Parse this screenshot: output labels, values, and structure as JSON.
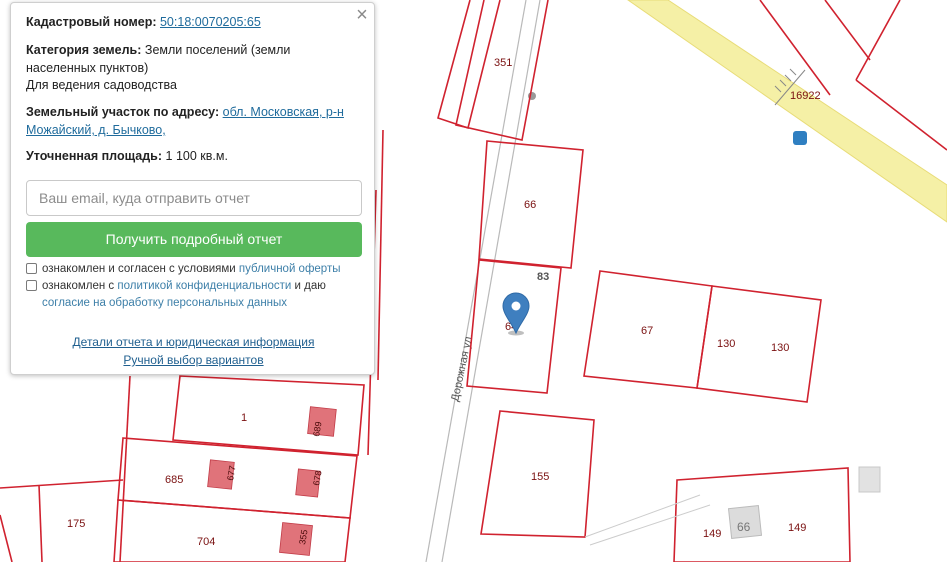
{
  "map": {
    "street_label": "Дорожная ул.",
    "plot_labels": {
      "p351": "351",
      "p16922": "16922",
      "p66": "66",
      "p83": "83",
      "pSel": "64",
      "p67": "67",
      "p130a": "130",
      "p130b": "130",
      "p155": "155",
      "p1": "1",
      "p685": "685",
      "p704": "704",
      "p175": "175",
      "p149a": "149",
      "p149b": "149"
    },
    "building_labels": {
      "b689": "689",
      "b677": "677",
      "b678": "678",
      "b355": "355",
      "b66": "66"
    },
    "colors": {
      "boundary": "#d0222f",
      "road": "#f5f0a6",
      "building": "#e0737a",
      "marker": "#3f7fbf"
    }
  },
  "popup": {
    "cadastral_label": "Кадастровый номер:",
    "cadastral_value": "50:18:0070205:65",
    "category_label": "Категория земель:",
    "category_value_1": "Земли поселений (земли",
    "category_value_2": "населенных пунктов)",
    "category_value_3": "Для ведения садоводства",
    "address_label": "Земельный участок по адресу:",
    "address_value_1": "обл. Московская, р-н",
    "address_value_2": "Можайский, д. Бычково,",
    "area_label": "Уточненная площадь:",
    "area_value": "1 100 кв.м.",
    "email_placeholder": "Ваш email, куда отправить отчет",
    "button_label": "Получить подробный отчет",
    "consent1_text": "ознакомлен и согласен с условиями",
    "consent1_link": "публичной оферты",
    "consent2_text_a": "ознакомлен с",
    "consent2_link_a": "политикой конфиденциальности",
    "consent2_text_b": "и даю",
    "consent2_link_b": "согласие на обработку персональных данных",
    "details_link": "Детали отчета и юридическая информация",
    "manual_link": "Ручной выбор вариантов"
  }
}
